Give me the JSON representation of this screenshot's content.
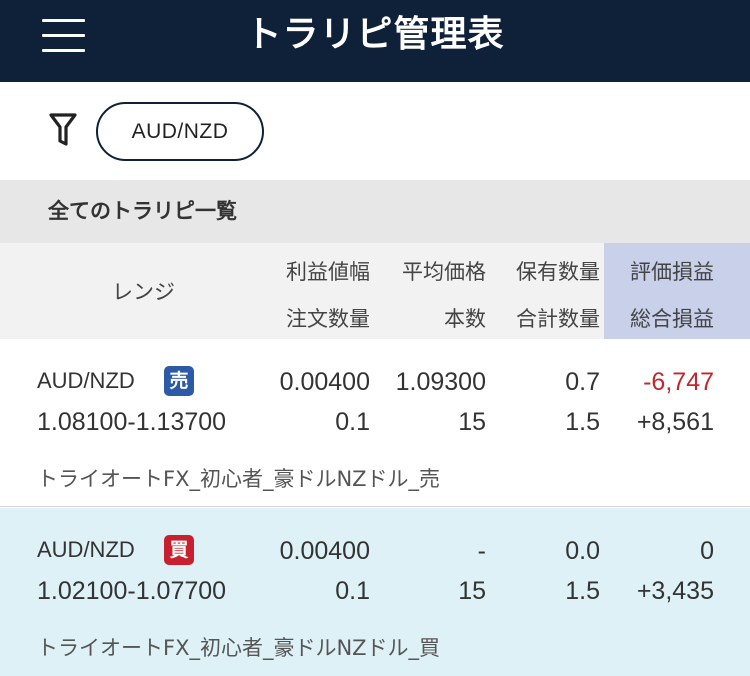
{
  "header": {
    "title": "トラリピ管理表",
    "menu_icon": "hamburger-menu-icon"
  },
  "filter": {
    "icon": "filter-icon",
    "selected_pair": "AUD/NZD"
  },
  "section": {
    "title": "全てのトラリピ一覧"
  },
  "columns": {
    "range": "レンジ",
    "profit_width": "利益値幅",
    "order_qty": "注文数量",
    "avg_price": "平均価格",
    "count": "本数",
    "holding_qty": "保有数量",
    "total_qty": "合計数量",
    "unrealized_pl": "評価損益",
    "total_pl": "総合損益"
  },
  "colors": {
    "header_bg": "#0f2039",
    "sell_badge": "#2d5aa6",
    "buy_badge": "#c8202f",
    "negative": "#c1272d",
    "highlight_col": "#c9d0ea",
    "buy_row_bg": "#def1f7"
  },
  "rows": [
    {
      "pair": "AUD/NZD",
      "side_label": "売",
      "range": "1.08100-1.13700",
      "profit_width": "0.00400",
      "order_qty": "0.1",
      "avg_price": "1.09300",
      "count": "15",
      "holding_qty": "0.7",
      "total_qty": "1.5",
      "unrealized_pl": "-6,747",
      "total_pl": "+8,561",
      "strategy": "トライオートFX_初心者_豪ドルNZドル_売"
    },
    {
      "pair": "AUD/NZD",
      "side_label": "買",
      "range": "1.02100-1.07700",
      "profit_width": "0.00400",
      "order_qty": "0.1",
      "avg_price": "-",
      "count": "15",
      "holding_qty": "0.0",
      "total_qty": "1.5",
      "unrealized_pl": "0",
      "total_pl": "+3,435",
      "strategy": "トライオートFX_初心者_豪ドルNZドル_買"
    }
  ]
}
